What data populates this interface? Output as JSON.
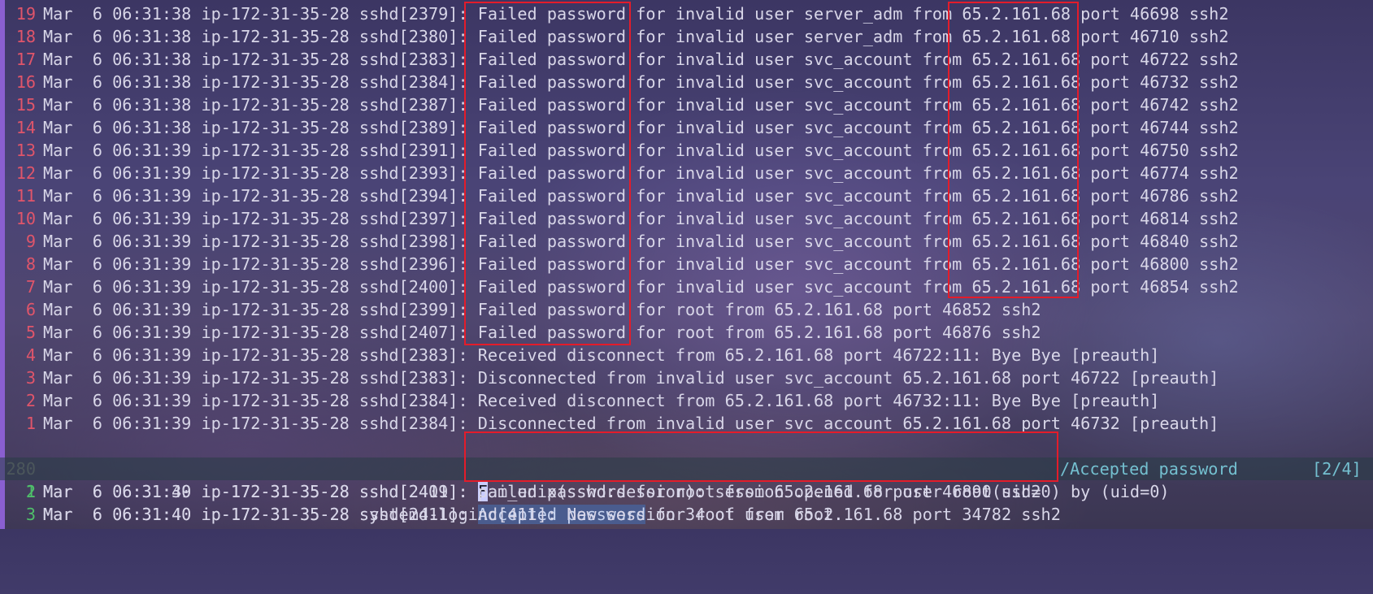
{
  "terminal": {
    "lines": [
      {
        "num": "19",
        "text": "Mar  6 06:31:38 ip-172-31-35-28 sshd[2379]: Failed password for invalid user server_adm from 65.2.161.68 port 46698 ssh2"
      },
      {
        "num": "18",
        "text": "Mar  6 06:31:38 ip-172-31-35-28 sshd[2380]: Failed password for invalid user server_adm from 65.2.161.68 port 46710 ssh2"
      },
      {
        "num": "17",
        "text": "Mar  6 06:31:38 ip-172-31-35-28 sshd[2383]: Failed password for invalid user svc_account from 65.2.161.68 port 46722 ssh2"
      },
      {
        "num": "16",
        "text": "Mar  6 06:31:38 ip-172-31-35-28 sshd[2384]: Failed password for invalid user svc_account from 65.2.161.68 port 46732 ssh2"
      },
      {
        "num": "15",
        "text": "Mar  6 06:31:38 ip-172-31-35-28 sshd[2387]: Failed password for invalid user svc_account from 65.2.161.68 port 46742 ssh2"
      },
      {
        "num": "14",
        "text": "Mar  6 06:31:38 ip-172-31-35-28 sshd[2389]: Failed password for invalid user svc_account from 65.2.161.68 port 46744 ssh2"
      },
      {
        "num": "13",
        "text": "Mar  6 06:31:39 ip-172-31-35-28 sshd[2391]: Failed password for invalid user svc_account from 65.2.161.68 port 46750 ssh2"
      },
      {
        "num": "12",
        "text": "Mar  6 06:31:39 ip-172-31-35-28 sshd[2393]: Failed password for invalid user svc_account from 65.2.161.68 port 46774 ssh2"
      },
      {
        "num": "11",
        "text": "Mar  6 06:31:39 ip-172-31-35-28 sshd[2394]: Failed password for invalid user svc_account from 65.2.161.68 port 46786 ssh2"
      },
      {
        "num": "10",
        "text": "Mar  6 06:31:39 ip-172-31-35-28 sshd[2397]: Failed password for invalid user svc_account from 65.2.161.68 port 46814 ssh2"
      },
      {
        "num": "9",
        "text": "Mar  6 06:31:39 ip-172-31-35-28 sshd[2398]: Failed password for invalid user svc_account from 65.2.161.68 port 46840 ssh2"
      },
      {
        "num": "8",
        "text": "Mar  6 06:31:39 ip-172-31-35-28 sshd[2396]: Failed password for invalid user svc_account from 65.2.161.68 port 46800 ssh2"
      },
      {
        "num": "7",
        "text": "Mar  6 06:31:39 ip-172-31-35-28 sshd[2400]: Failed password for invalid user svc_account from 65.2.161.68 port 46854 ssh2"
      },
      {
        "num": "6",
        "text": "Mar  6 06:31:39 ip-172-31-35-28 sshd[2399]: Failed password for root from 65.2.161.68 port 46852 ssh2"
      },
      {
        "num": "5",
        "text": "Mar  6 06:31:39 ip-172-31-35-28 sshd[2407]: Failed password for root from 65.2.161.68 port 46876 ssh2"
      },
      {
        "num": "4",
        "text": "Mar  6 06:31:39 ip-172-31-35-28 sshd[2383]: Received disconnect from 65.2.161.68 port 46722:11: Bye Bye [preauth]"
      },
      {
        "num": "3",
        "text": "Mar  6 06:31:39 ip-172-31-35-28 sshd[2383]: Disconnected from invalid user svc_account 65.2.161.68 port 46722 [preauth]"
      },
      {
        "num": "2",
        "text": "Mar  6 06:31:39 ip-172-31-35-28 sshd[2384]: Received disconnect from 65.2.161.68 port 46732:11: Bye Bye [preauth]"
      },
      {
        "num": "1",
        "text": "Mar  6 06:31:39 ip-172-31-35-28 sshd[2384]: Disconnected from invalid user svc_account 65.2.161.68 port 46732 [preauth]"
      }
    ],
    "current_line": {
      "num": "280",
      "prefix": "Mar  6 06:31:39 ip-172-31-35-28 sshd[2409]: ",
      "cursor_char": "F",
      "suffix": "ailed password for root from 65.2.161.68 port 46890 ssh2"
    },
    "accepted_line": {
      "num": "1",
      "prefix": "Mar  6 06:31:40 ip-172-31-35-28 sshd[2411]: ",
      "match": "Accepted password",
      "suffix": " for root from 65.2.161.68 port 34782 ssh2"
    },
    "after_lines": [
      {
        "num": "2",
        "text": "Mar  6 06:31:40 ip-172-31-35-28 sshd[2411]: pam_unix(sshd:session): session opened for user root(uid=0) by (uid=0)"
      },
      {
        "num": "3",
        "text": "Mar  6 06:31:40 ip-172-31-35-28 systemd-logind[411]: New session 34 of user root."
      }
    ],
    "search": {
      "query": "/Accepted password",
      "count": "[2/4]"
    }
  },
  "colors": {
    "annotation_box": "#e41c2a",
    "relative_line_number": "#e0556a",
    "after_line_number": "#4fbf6a",
    "current_line_number": "#767676",
    "search_match_background": "#4a5c8e",
    "search_prompt": "#74c0d0",
    "left_border": "#8a5fd0"
  }
}
